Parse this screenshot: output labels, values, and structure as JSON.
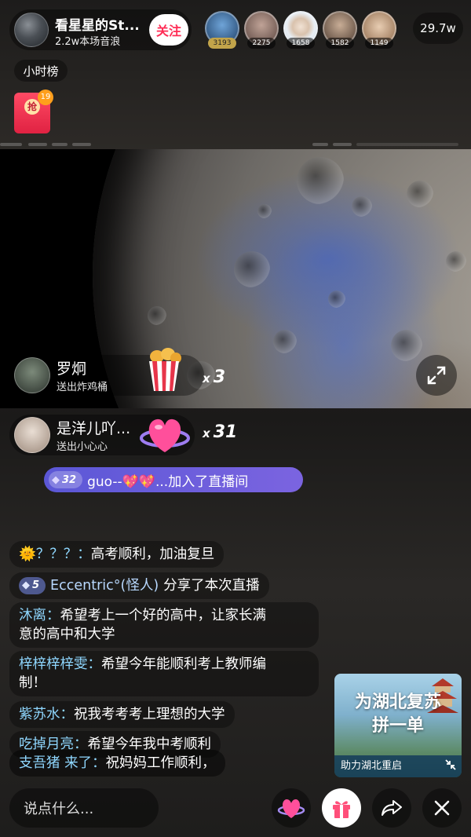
{
  "header": {
    "anchor_name": "看星星的St...",
    "anchor_stats": "2.2w本场音浪",
    "follow_label": "关注",
    "viewers": [
      {
        "count": "3193",
        "badge": "gold",
        "color": "#2d5b8c"
      },
      {
        "count": "2275",
        "badge": "dark",
        "color": "#8b6d63"
      },
      {
        "count": "1658",
        "badge": "dark",
        "color": "#cfd8e2"
      },
      {
        "count": "1582",
        "badge": "dark",
        "color": "#9a7f6c"
      },
      {
        "count": "1149",
        "badge": "dark",
        "color": "#c9a989"
      }
    ],
    "total_viewers": "29.7w",
    "rank_tag": "小时榜",
    "red_packet": {
      "label": "抢",
      "count": "19"
    }
  },
  "gifts": [
    {
      "user": "罗炯",
      "action": "送出炸鸡桶",
      "gift": "fried-chicken-bucket",
      "combo_prefix": "x",
      "combo": "3"
    },
    {
      "user": "是洋儿吖...",
      "action": "送出小心心",
      "gift": "heart-planet",
      "combo_prefix": "x",
      "combo": "31"
    }
  ],
  "join_notice": {
    "level": "32",
    "text": "guo--💖💖...加入了直播间"
  },
  "chat": [
    {
      "nick": "🌞？？？：",
      "msg": "高考顺利，加油复旦"
    },
    {
      "level": "5",
      "nick": "Eccentric°(怪人)",
      "msg": "分享了本次直播"
    },
    {
      "nick": "沐离：",
      "msg": "希望考上一个好的高中，让家长满",
      "msg2": "意的高中和大学"
    },
    {
      "nick": "梓梓梓梓雯：",
      "msg": "希望今年能顺利考上教师编",
      "msg2": "制！"
    },
    {
      "nick": "紫苏水：",
      "msg": "祝我考考考上理想的大学"
    },
    {
      "nick": "吃掉月亮：",
      "msg": "希望今年我中考顺利"
    },
    {
      "nick": "支吾猪 来了",
      "nick_suffix": "：",
      "msg": "祝妈妈工作顺利，"
    }
  ],
  "ad": {
    "title_line1": "为湖北复苏",
    "title_line2": "拼一单",
    "footer": "助力湖北重启"
  },
  "bottom": {
    "placeholder": "说点什么..."
  },
  "colors": {
    "accent_follow": "#ff2c55",
    "nick": "#8fd7ff",
    "join_bg": "#5b57d6"
  }
}
